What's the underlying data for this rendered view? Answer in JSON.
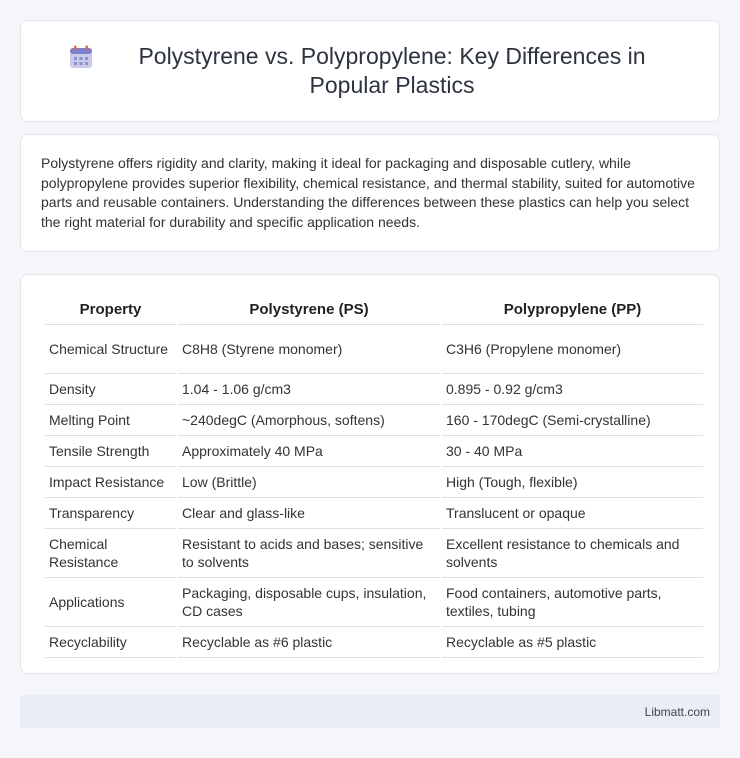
{
  "header": {
    "title": "Polystyrene vs. Polypropylene: Key Differences in Popular Plastics",
    "icon": "calendar-icon"
  },
  "intro": {
    "text": "Polystyrene offers rigidity and clarity, making it ideal for packaging and disposable cutlery, while polypropylene provides superior flexibility, chemical resistance, and thermal stability, suited for automotive parts and reusable containers. Understanding the differences between these plastics can help you select the right material for durability and specific application needs."
  },
  "table": {
    "headers": [
      "Property",
      "Polystyrene (PS)",
      "Polypropylene (PP)"
    ],
    "rows": [
      [
        "Chemical Structure",
        "C8H8 (Styrene monomer)",
        "C3H6 (Propylene monomer)"
      ],
      [
        "Density",
        "1.04 - 1.06 g/cm3",
        "0.895 - 0.92 g/cm3"
      ],
      [
        "Melting Point",
        "~240degC (Amorphous, softens)",
        "160 - 170degC (Semi-crystalline)"
      ],
      [
        "Tensile Strength",
        "Approximately 40 MPa",
        "30 - 40 MPa"
      ],
      [
        "Impact Resistance",
        "Low (Brittle)",
        "High (Tough, flexible)"
      ],
      [
        "Transparency",
        "Clear and glass-like",
        "Translucent or opaque"
      ],
      [
        "Chemical Resistance",
        "Resistant to acids and bases; sensitive to solvents",
        "Excellent resistance to chemicals and solvents"
      ],
      [
        "Applications",
        "Packaging, disposable cups, insulation, CD cases",
        "Food containers, automotive parts, textiles, tubing"
      ],
      [
        "Recyclability",
        "Recyclable as #6 plastic",
        "Recyclable as #5 plastic"
      ]
    ]
  },
  "footer": {
    "text": "Libmatt.com"
  }
}
